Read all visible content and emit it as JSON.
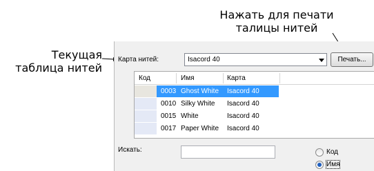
{
  "callouts": {
    "print_line1": "Нажать для печати",
    "print_line2": "талицы нитей",
    "current_line1": "Текущая",
    "current_line2": "таблица нитей"
  },
  "toolbar": {
    "chart_label": "Карта нитей:",
    "chart_value": "Isacord 40",
    "print_button": "Печать..."
  },
  "grid": {
    "columns": [
      "Код",
      "Имя",
      "Карта"
    ],
    "rows": [
      {
        "code": "0003",
        "name": "Ghost White",
        "chart": "Isacord 40",
        "selected": true
      },
      {
        "code": "0010",
        "name": "Silky White",
        "chart": "Isacord 40",
        "selected": false
      },
      {
        "code": "0015",
        "name": "White",
        "chart": "Isacord 40",
        "selected": false
      },
      {
        "code": "0017",
        "name": "Paper White",
        "chart": "Isacord 40",
        "selected": false
      }
    ]
  },
  "search": {
    "label": "Искать:",
    "value": "",
    "options": [
      {
        "label": "Код",
        "checked": false
      },
      {
        "label": "Имя",
        "checked": true
      }
    ]
  },
  "colors": {
    "selection": "#3399ff",
    "swatch": "#e4e9f6",
    "first_swatch": "#e8e6df"
  },
  "icons": {
    "combo": "chevron-down-icon",
    "callout": "arrow-icon"
  }
}
